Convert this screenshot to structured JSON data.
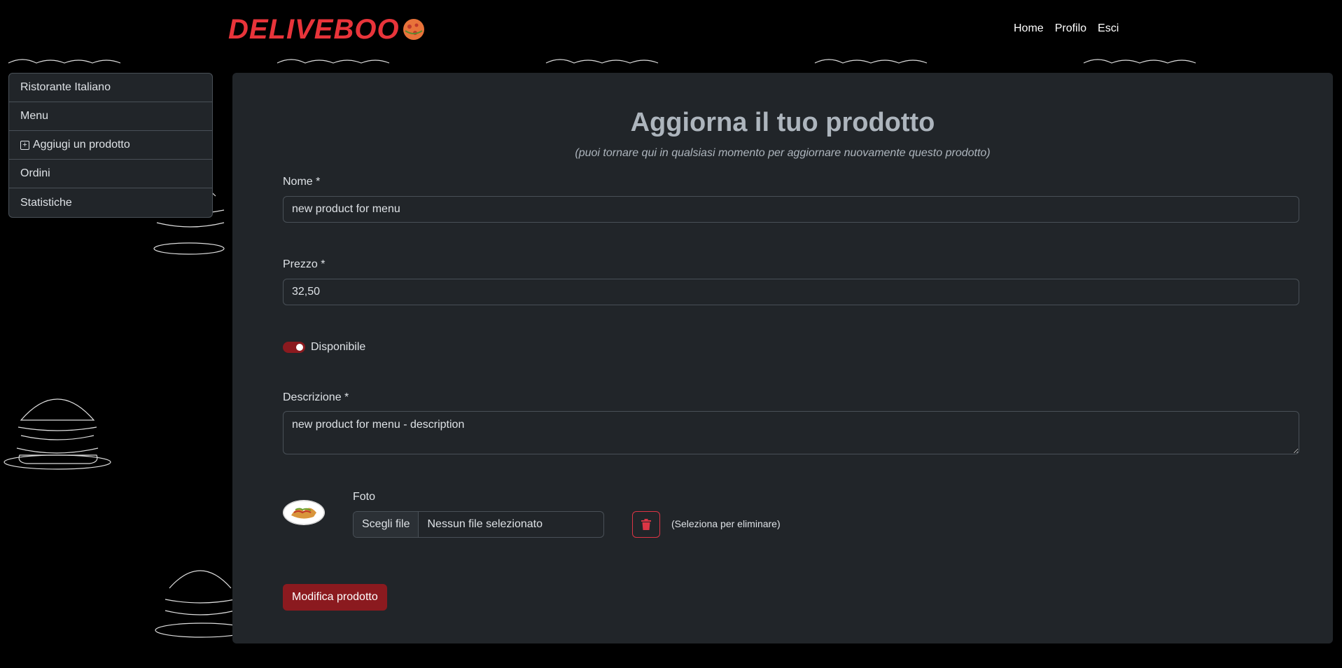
{
  "brand": {
    "logo_text": "DELIVEBOO"
  },
  "nav": {
    "links": [
      {
        "label": "Home"
      },
      {
        "label": "Profilo"
      },
      {
        "label": "Esci"
      }
    ]
  },
  "sidebar": {
    "items": [
      {
        "label": "Ristorante Italiano",
        "icon": ""
      },
      {
        "label": "Menu",
        "icon": ""
      },
      {
        "label": "Aggiugi un prodotto",
        "icon": "plus-square-icon"
      },
      {
        "label": "Ordini",
        "icon": ""
      },
      {
        "label": "Statistiche",
        "icon": ""
      }
    ]
  },
  "form": {
    "title": "Aggiorna il tuo prodotto",
    "subtitle": "(puoi tornare qui in qualsiasi momento per aggiornare nuovamente questo prodotto)",
    "name": {
      "label": "Nome *",
      "value": "new product for menu"
    },
    "price": {
      "label": "Prezzo *",
      "value": "32,50"
    },
    "available": {
      "label": "Disponibile",
      "checked": true
    },
    "description": {
      "label": "Descrizione *",
      "value": "new product for menu - description"
    },
    "photo": {
      "label": "Foto",
      "choose_button": "Scegli file",
      "file_status": "Nessun file selezionato",
      "delete_note": "(Seleziona per eliminare)"
    },
    "submit_label": "Modifica prodotto"
  },
  "colors": {
    "background": "#000000",
    "card": "#212529",
    "accent": "#8b1a1f",
    "danger": "#dc3545",
    "logo": "#e8343a"
  }
}
